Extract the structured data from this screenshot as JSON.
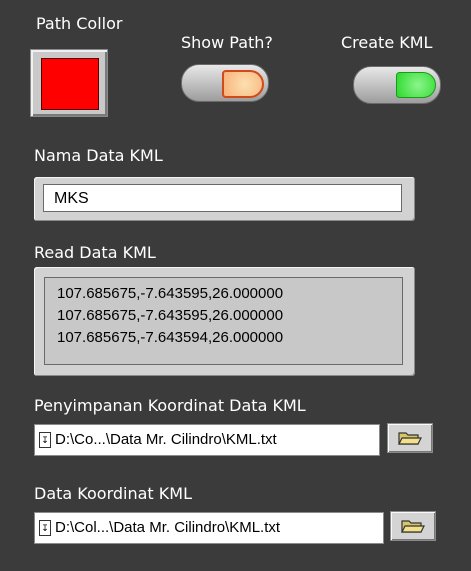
{
  "path_color": {
    "label": "Path Collor",
    "value": "#ff0000"
  },
  "show_path": {
    "label": "Show Path?",
    "led_color": "#f7b27a",
    "led_border": "#d24a1a"
  },
  "create_kml": {
    "label": "Create KML",
    "led_color": "#2bd92b",
    "led_border": "#1a9a1a"
  },
  "nama_data": {
    "label": "Nama Data KML",
    "value": "MKS"
  },
  "read_data": {
    "label": "Read Data KML",
    "lines": [
      "107.685675,-7.643595,26.000000",
      "107.685675,-7.643595,26.000000",
      "107.685675,-7.643594,26.000000"
    ]
  },
  "penyimpanan": {
    "label": "Penyimpanan Koordinat Data KML",
    "path": "D:\\Co...\\Data Mr. Cilindro\\KML.txt"
  },
  "data_koordinat": {
    "label": "Data Koordinat KML",
    "path": "D:\\Col...\\Data Mr. Cilindro\\KML.txt"
  },
  "icons": {
    "browse": "folder-open-icon",
    "path_glyph": "path-icon"
  }
}
